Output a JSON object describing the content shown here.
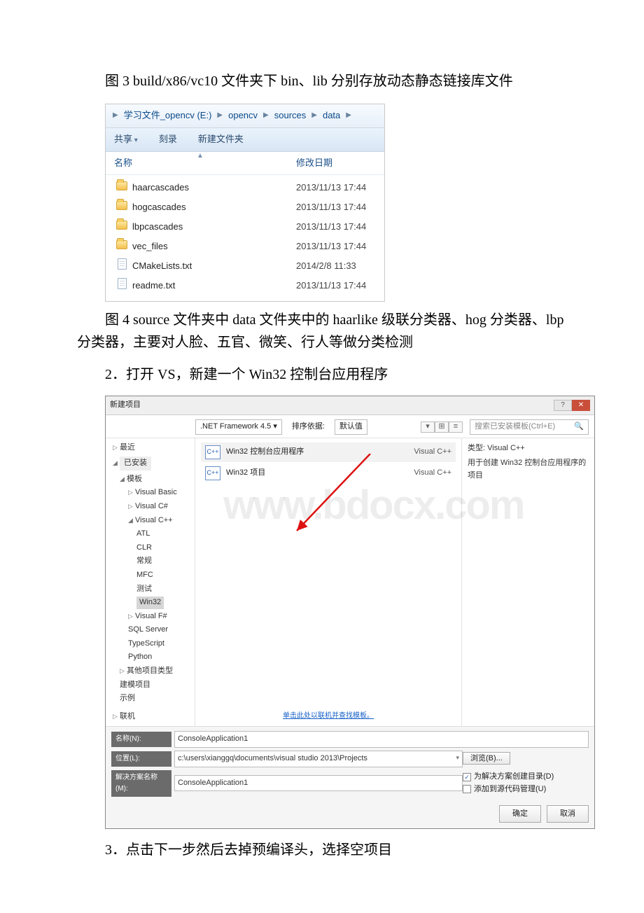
{
  "captions": {
    "fig3": "图 3 build/x86/vc10 文件夹下 bin、lib 分别存放动态静态链接库文件",
    "fig4": "图 4 source 文件夹中 data 文件夹中的 haarlike 级联分类器、hog 分类器、lbp 分类器，主要对人脸、五官、微笑、行人等做分类检测",
    "step2": "2．打开 VS，新建一个 Win32 控制台应用程序",
    "step3": "3．点击下一步然后去掉预编译头，选择空项目"
  },
  "explorer": {
    "path_segments": [
      "学习文件_opencv (E:)",
      "opencv",
      "sources",
      "data"
    ],
    "toolbar": {
      "share": "共享",
      "burn": "刻录",
      "newfolder": "新建文件夹"
    },
    "columns": {
      "name": "名称",
      "modified": "修改日期"
    },
    "rows": [
      {
        "icon": "folder",
        "name": "haarcascades",
        "modified": "2013/11/13 17:44"
      },
      {
        "icon": "folder",
        "name": "hogcascades",
        "modified": "2013/11/13 17:44"
      },
      {
        "icon": "folder",
        "name": "lbpcascades",
        "modified": "2013/11/13 17:44"
      },
      {
        "icon": "folder",
        "name": "vec_files",
        "modified": "2013/11/13 17:44"
      },
      {
        "icon": "file",
        "name": "CMakeLists.txt",
        "modified": "2014/2/8 11:33"
      },
      {
        "icon": "file",
        "name": "readme.txt",
        "modified": "2013/11/13 17:44"
      }
    ]
  },
  "vs": {
    "title": "新建项目",
    "framework": ".NET Framework 4.5",
    "sort_label": "排序依据:",
    "sort_value": "默认值",
    "search_placeholder": "搜索已安装模板(Ctrl+E)",
    "tree": {
      "recent": "最近",
      "installed": "已安装",
      "templates": "模板",
      "langs": {
        "visual_basic": "Visual Basic",
        "visual_csharp": "Visual C#",
        "visual_cpp": "Visual C++",
        "cpp_children": [
          "ATL",
          "CLR",
          "常规",
          "MFC",
          "测试",
          "Win32"
        ],
        "visual_fsharp": "Visual F#",
        "sql_server": "SQL Server",
        "typescript": "TypeScript",
        "python": "Python"
      },
      "other_types": "其他项目类型",
      "modeling": "建模项目",
      "samples": "示例",
      "online": "联机"
    },
    "templates": [
      {
        "name": "Win32 控制台应用程序",
        "lang": "Visual C++"
      },
      {
        "name": "Win32 项目",
        "lang": "Visual C++"
      }
    ],
    "online_link": "单击此处以联机并查找模板。",
    "right_panel": {
      "type_label": "类型:",
      "type_value": "Visual C++",
      "description": "用于创建 Win32 控制台应用程序的项目"
    },
    "bottom": {
      "name_label": "名称(N):",
      "name_value": "ConsoleApplication1",
      "location_label": "位置(L):",
      "location_value": "c:\\users\\xianggq\\documents\\visual studio 2013\\Projects",
      "browse": "浏览(B)...",
      "solution_label": "解决方案名称(M):",
      "solution_value": "ConsoleApplication1",
      "chk_create_dir": "为解决方案创建目录(D)",
      "chk_add_scc": "添加到源代码管理(U)"
    },
    "actions": {
      "ok": "确定",
      "cancel": "取消"
    },
    "watermark": "www.bdocx.com"
  }
}
